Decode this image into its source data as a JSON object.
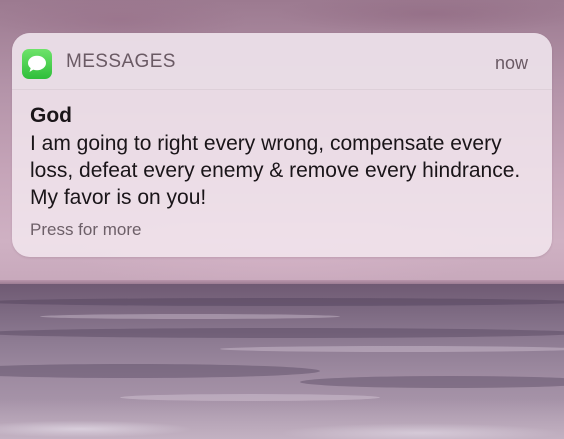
{
  "notification": {
    "app_name": "MESSAGES",
    "timestamp": "now",
    "sender": "God",
    "message": "I am going to right every wrong, compensate every loss, defeat every enemy & remove every hindrance. My favor is on you!",
    "action_hint": "Press for more",
    "app_icon": "messages-bubble-icon",
    "app_icon_color": "#34c759"
  },
  "background": {
    "description_colors": {
      "sky": "#c5a4b8",
      "sea": "#7d6a82"
    }
  }
}
